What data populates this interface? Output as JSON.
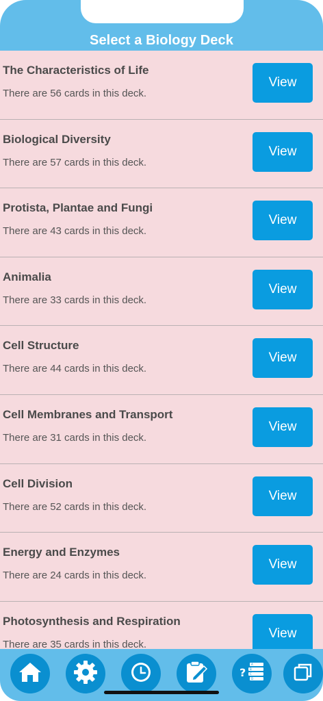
{
  "header": {
    "title": "Select a Biology Deck"
  },
  "decks": [
    {
      "title": "The Characteristics of Life",
      "subtitle": "There are 56 cards in this deck.",
      "button": "View"
    },
    {
      "title": "Biological Diversity",
      "subtitle": "There are 57 cards in this deck.",
      "button": "View"
    },
    {
      "title": "Protista, Plantae and Fungi",
      "subtitle": "There are 43 cards in this deck.",
      "button": "View"
    },
    {
      "title": "Animalia",
      "subtitle": "There are 33 cards in this deck.",
      "button": "View"
    },
    {
      "title": "Cell Structure",
      "subtitle": "There are 44 cards in this deck.",
      "button": "View"
    },
    {
      "title": "Cell Membranes and Transport",
      "subtitle": "There are 31 cards in this deck.",
      "button": "View"
    },
    {
      "title": "Cell Division",
      "subtitle": "There are 52 cards in this deck.",
      "button": "View"
    },
    {
      "title": "Energy and Enzymes",
      "subtitle": "There are 24 cards in this deck.",
      "button": "View"
    },
    {
      "title": "Photosynthesis and Respiration",
      "subtitle": "There are 35 cards in this deck.",
      "button": "View"
    }
  ],
  "tabbar": {
    "items": [
      {
        "icon": "home-icon"
      },
      {
        "icon": "gear-icon"
      },
      {
        "icon": "clock-icon"
      },
      {
        "icon": "notepad-pencil-icon"
      },
      {
        "icon": "quiz-list-icon"
      },
      {
        "icon": "copy-cards-icon"
      }
    ]
  },
  "colors": {
    "header": "#62bdea",
    "list_background": "#f6dade",
    "button": "#0a9ce0",
    "tab_circle": "#0a8fd0"
  }
}
